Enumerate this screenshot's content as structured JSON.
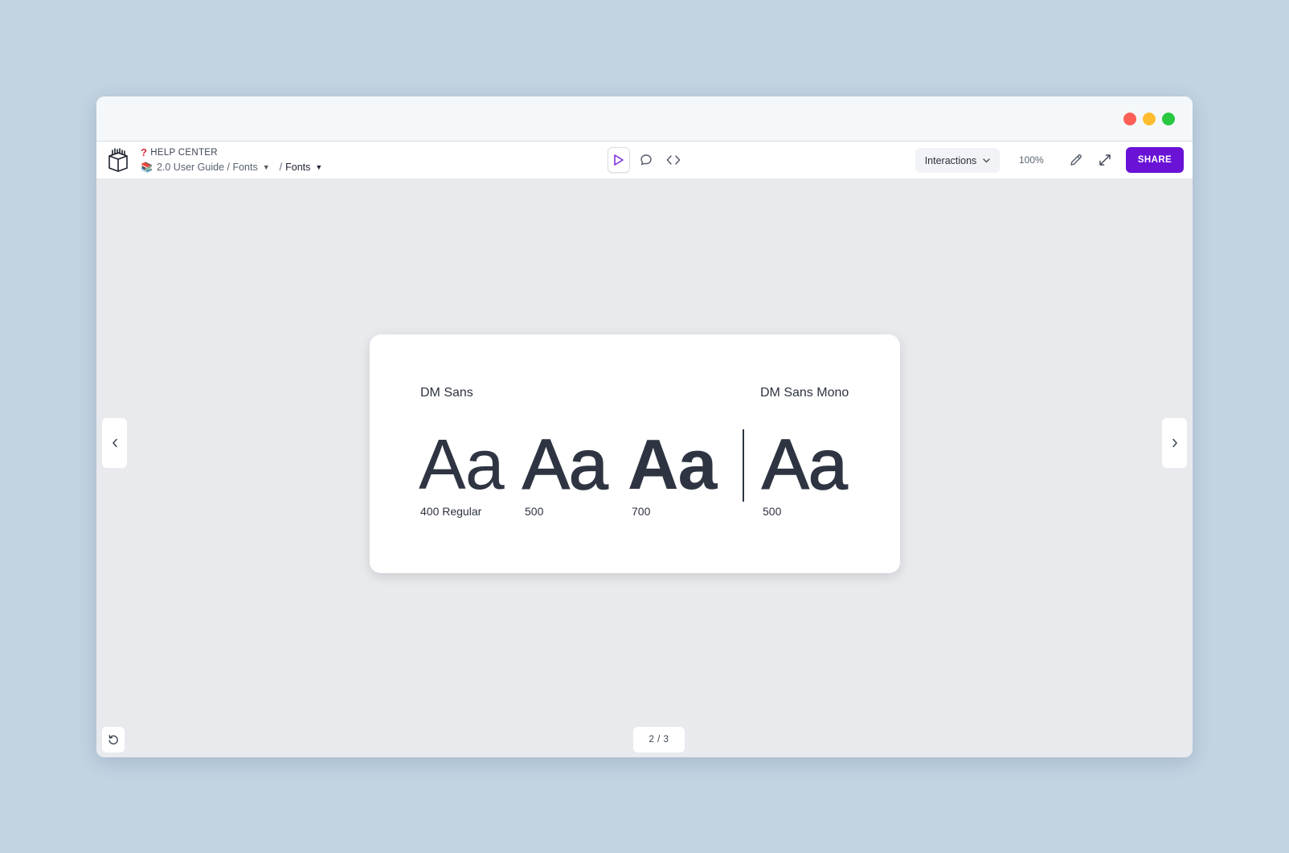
{
  "breadcrumb": {
    "section_icon": "question-mark-icon",
    "section_label": "HELP CENTER",
    "book_icon": "books-icon",
    "path_label": "2.0 User Guide / Fonts",
    "separator": "/",
    "current_label": "Fonts"
  },
  "toolbar": {
    "play_icon": "play-icon",
    "comment_icon": "comment-icon",
    "code_icon": "code-icon",
    "interactions_label": "Interactions",
    "zoom_label": "100%",
    "edit_icon": "pencil-icon",
    "expand_icon": "expand-icon",
    "share_label": "SHARE"
  },
  "slide": {
    "left_font_name": "DM Sans",
    "right_font_name": "DM Sans Mono",
    "samples": [
      {
        "glyphs": "Aa",
        "weight_label": "400 Regular"
      },
      {
        "glyphs": "Aa",
        "weight_label": "500"
      },
      {
        "glyphs": "Aa",
        "weight_label": "700"
      },
      {
        "glyphs": "Aa",
        "weight_label": "500"
      }
    ]
  },
  "pager": {
    "label": "2 / 3"
  },
  "colors": {
    "accent": "#6a12d6",
    "background": "#c2d4e2",
    "canvas": "#e8eaee"
  }
}
